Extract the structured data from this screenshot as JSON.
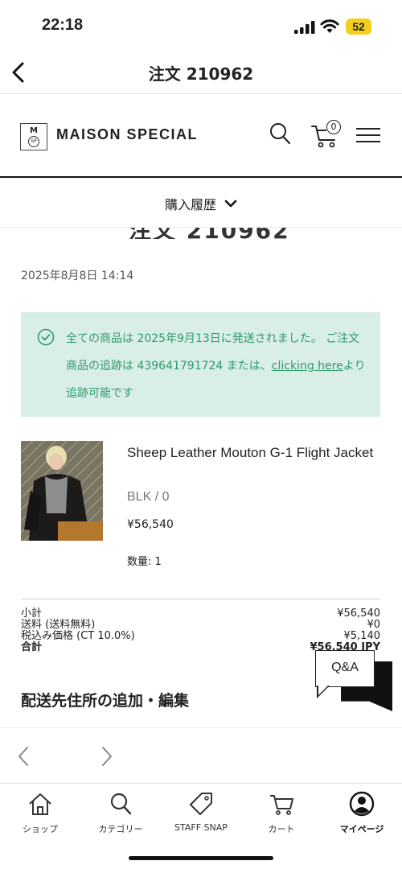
{
  "status_bar": {
    "time": "22:18",
    "battery": "52"
  },
  "header": {
    "title": "注文 210962"
  },
  "brand": {
    "logo_m": "M",
    "logo_sp": "SP",
    "name": "MAISON SPECIAL",
    "cart_count": "0"
  },
  "history": {
    "label": "購入履歴"
  },
  "order": {
    "title": "注文 210962",
    "date": "2025年8月8日 14:14"
  },
  "notice": {
    "text_before": "全ての商品は 2025年9月13日に発送されました。 ご注文商品の追跡は 439641791724 または、",
    "link": "clicking here",
    "text_after": "より追跡可能です"
  },
  "product": {
    "name": "Sheep Leather Mouton G-1 Flight Jacket",
    "variant": "BLK / 0",
    "price": "¥56,540",
    "qty": "数量: 1"
  },
  "summary": {
    "rows": [
      {
        "label": "小計",
        "value": "¥56,540"
      },
      {
        "label": "送料 (送料無料)",
        "value": "¥0"
      },
      {
        "label": "税込み価格 (CT 10.0%)",
        "value": "¥5,140"
      },
      {
        "label": "合計",
        "value": "¥56,540 JPY"
      }
    ]
  },
  "address": {
    "title": "配送先住所の追加・編集"
  },
  "qa": {
    "label": "Q&A"
  },
  "tabbar": {
    "items": [
      {
        "label": "ショップ",
        "icon": "home-icon"
      },
      {
        "label": "カテゴリー",
        "icon": "search-icon"
      },
      {
        "label": "STAFF SNAP",
        "icon": "tag-icon"
      },
      {
        "label": "カート",
        "icon": "cart-icon"
      },
      {
        "label": "マイページ",
        "icon": "account-icon"
      }
    ]
  },
  "colors": {
    "notice_bg": "#d9eee7",
    "notice_text": "#2f9b6e",
    "battery": "#f5cf1d"
  }
}
